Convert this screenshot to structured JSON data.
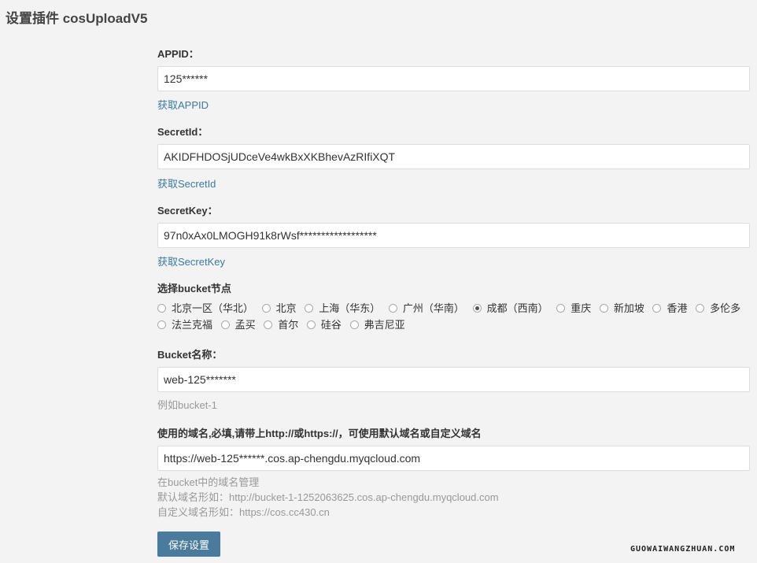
{
  "page": {
    "title": "设置插件 cosUploadV5"
  },
  "appid": {
    "label": "APPID：",
    "value": "125******",
    "link": "获取APPID"
  },
  "secret_id": {
    "label": "SecretId：",
    "value": "AKIDFHDOSjUDceVe4wkBxXKBhevAzRIfiXQT",
    "link": "获取SecretId"
  },
  "secret_key": {
    "label": "SecretKey：",
    "value": "97n0xAx0LMOGH91k8rWsf******************",
    "link": "获取SecretKey"
  },
  "region": {
    "label": "选择bucket节点",
    "options": [
      {
        "label": "北京一区（华北）",
        "checked": false
      },
      {
        "label": "北京",
        "checked": false
      },
      {
        "label": "上海（华东）",
        "checked": false
      },
      {
        "label": "广州（华南）",
        "checked": false
      },
      {
        "label": "成都（西南）",
        "checked": true
      },
      {
        "label": "重庆",
        "checked": false
      },
      {
        "label": "新加坡",
        "checked": false
      },
      {
        "label": "香港",
        "checked": false
      },
      {
        "label": "多伦多",
        "checked": false
      },
      {
        "label": "法兰克福",
        "checked": false
      },
      {
        "label": "孟买",
        "checked": false
      },
      {
        "label": "首尔",
        "checked": false
      },
      {
        "label": "硅谷",
        "checked": false
      },
      {
        "label": "弗吉尼亚",
        "checked": false
      }
    ]
  },
  "bucket": {
    "label": "Bucket名称：",
    "value": "web-125*******",
    "hint": "例如bucket-1"
  },
  "domain": {
    "label": "使用的域名,必填,请带上http://或https://，可使用默认域名或自定义域名",
    "value": "https://web-125******.cos.ap-chengdu.myqcloud.com",
    "hint_1": "在bucket中的域名管理",
    "hint_2": "默认域名形如：http://bucket-1-1252063625.cos.ap-chengdu.myqcloud.com",
    "hint_3": "自定义域名形如：https://cos.cc430.cn"
  },
  "save_button": {
    "label": "保存设置"
  },
  "watermark": {
    "text": "GUOWAIWANGZHUAN.COM"
  }
}
